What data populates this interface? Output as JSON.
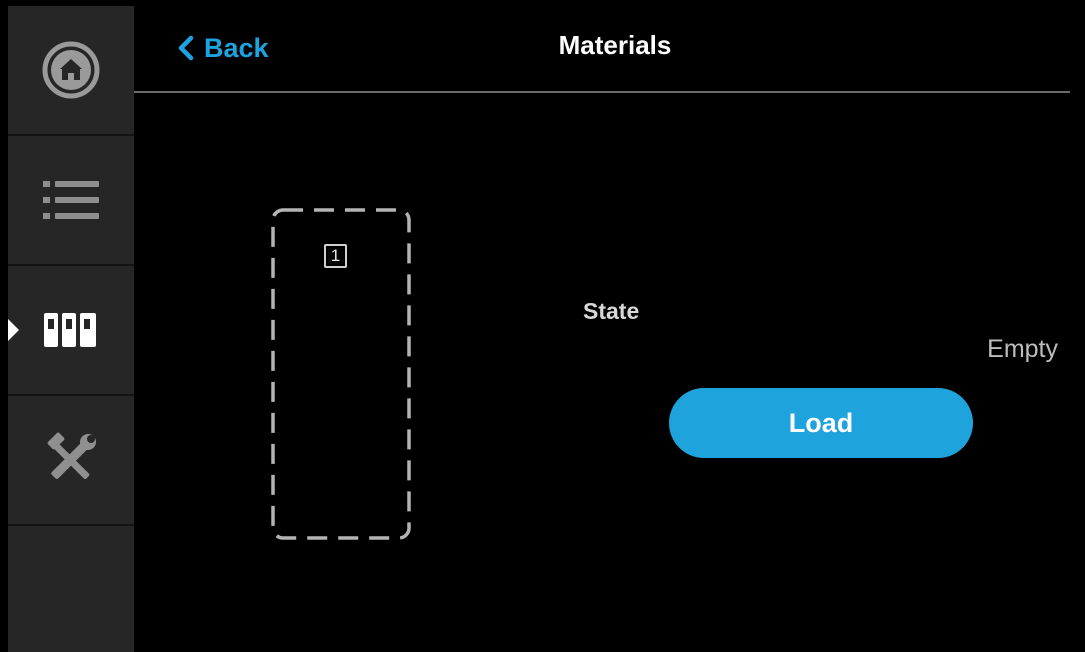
{
  "header": {
    "back_label": "Back",
    "title": "Materials"
  },
  "sidebar": {
    "items": [
      {
        "icon": "home-icon",
        "active": false
      },
      {
        "icon": "list-icon",
        "active": false
      },
      {
        "icon": "materials-icon",
        "active": true
      },
      {
        "icon": "tools-icon",
        "active": false
      }
    ]
  },
  "slot": {
    "number": "1"
  },
  "state": {
    "label": "State",
    "value": "Empty"
  },
  "actions": {
    "load_label": "Load"
  },
  "colors": {
    "accent": "#1fa3dc",
    "sidebar_bg": "#262626",
    "background": "#000000"
  }
}
